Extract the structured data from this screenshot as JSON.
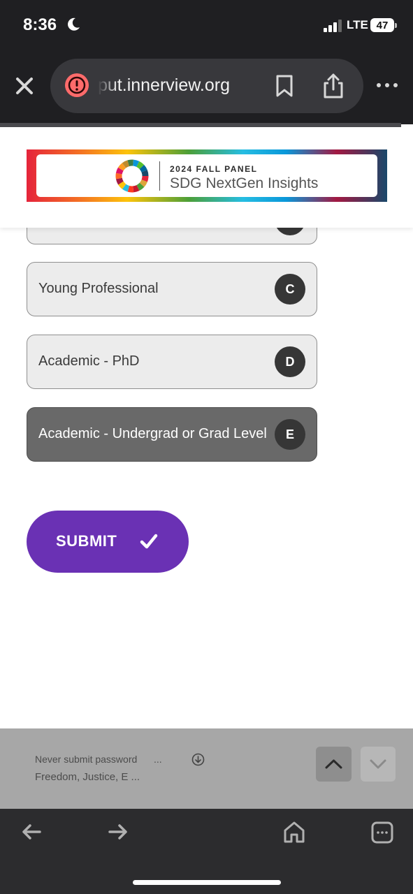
{
  "status_bar": {
    "time": "8:36",
    "network": "LTE",
    "battery": "47"
  },
  "browser": {
    "url": "put.innerview.org",
    "icons": {
      "close": "close-icon",
      "alert": "alert-icon",
      "bookmark": "bookmark-icon",
      "share": "share-icon",
      "more": "more-icon"
    }
  },
  "header": {
    "banner_title": "2024 FALL PANEL",
    "banner_subtitle": "SDG NextGen Insights"
  },
  "options": [
    {
      "label": "Young Professional",
      "badge": "C",
      "selected": false
    },
    {
      "label": "Academic - PhD",
      "badge": "D",
      "selected": false
    },
    {
      "label": "Academic - Undergrad or Grad Level",
      "badge": "E",
      "selected": true
    }
  ],
  "submit": {
    "label": "SUBMIT",
    "color": "#6a31b4"
  },
  "suggestions": {
    "line1": "Never submit password",
    "line1_ellipsis": "...",
    "line2": "Freedom, Justice, E ..."
  },
  "toolbar": {
    "icons": [
      "back-icon",
      "forward-icon",
      "home-icon",
      "tabs-icon"
    ]
  },
  "colors": {
    "accent": "#6a31b4",
    "selected_option": "#696969",
    "chrome": "#1f1f22"
  }
}
